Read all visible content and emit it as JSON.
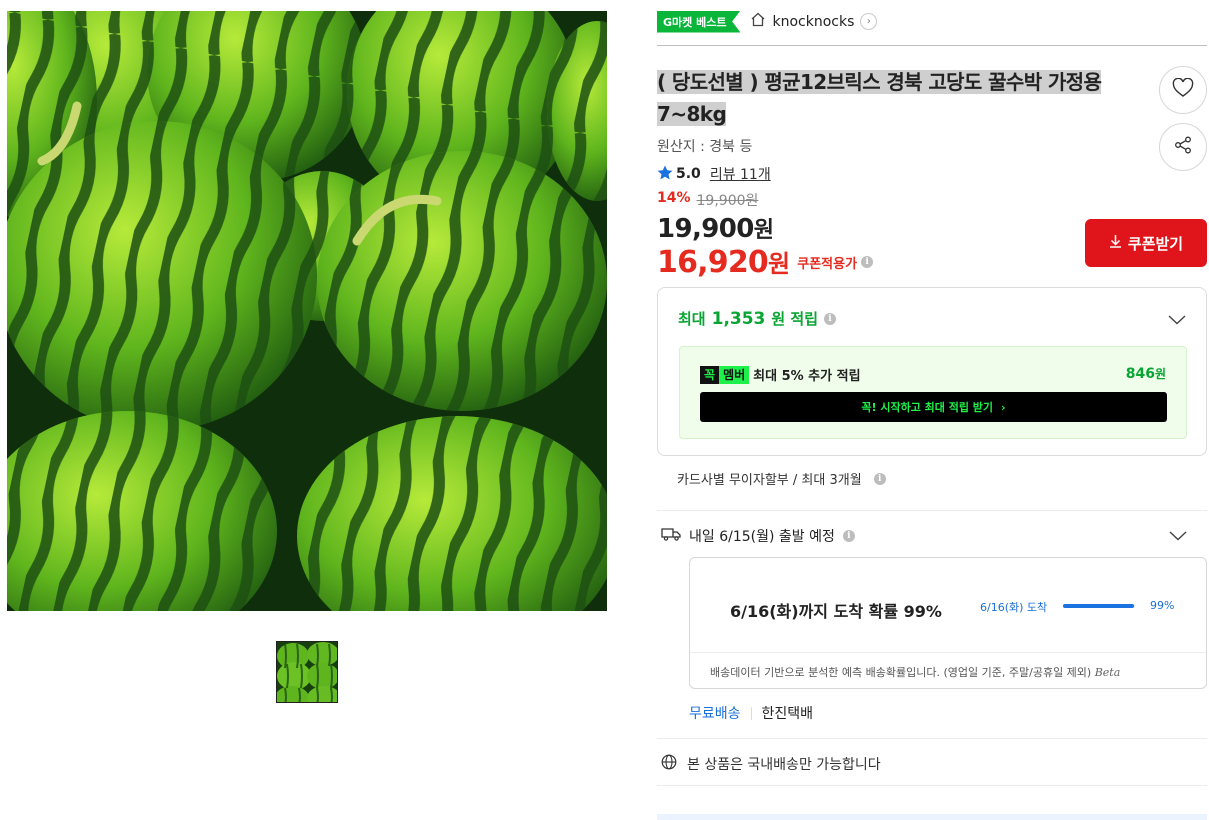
{
  "header": {
    "best_badge": "G마켓 베스트",
    "shop_name": "knocknocks"
  },
  "product": {
    "title_line1": "( 당도선별 ) 평균12브릭스 경북 고당도 꿀수박 가정용",
    "title_line2": "7~8kg",
    "origin": "원산지 : 경북 등",
    "rating_score": "5.0",
    "review_text": "리뷰 11개",
    "discount_pct": "14%",
    "original_price": "19,900원",
    "price_num": "19,900",
    "price_unit": "원",
    "coupon_price_num": "16,920",
    "coupon_price_unit": "원",
    "coupon_apply_label": "쿠폰적용가",
    "coupon_button": "쿠폰받기"
  },
  "reward": {
    "prefix": "최대",
    "amount": "1,353",
    "suffix": "원 적립",
    "member_logo_a": "꼭",
    "member_logo_b": "멤버",
    "member_text": "최대 5% 추가 적립",
    "member_amount": "846",
    "member_amount_unit": "원",
    "member_cta": "꼭! 시작하고 최대 적립 받기"
  },
  "installment": "카드사별 무이자할부 / 최대 3개월",
  "shipping": {
    "departure": "내일 6/15(월) 출발 예정",
    "prediction_title": "6/16(화)까지 도착 확률 99%",
    "prediction_label": "6/16(화) 도착",
    "prediction_pct": "99%",
    "prediction_fraction": 0.99,
    "prediction_note": "배송데이터 기반으로 분석한 예측 배송확률입니다. (영업일 기준, 주말/공휴일 제외)",
    "beta_label": "Beta",
    "free_shipping": "무료배송",
    "courier": "한진택배",
    "domestic_note": "본 상품은 국내배송만 가능합니다"
  },
  "icons": {
    "heart": "heart-icon",
    "share": "share-icon",
    "star": "star-icon",
    "home": "home-icon",
    "truck": "truck-icon",
    "globe": "globe-icon",
    "download": "download-icon"
  },
  "colors": {
    "accent_red": "#e0151b",
    "green": "#09b63a",
    "blue": "#1a72e0"
  }
}
